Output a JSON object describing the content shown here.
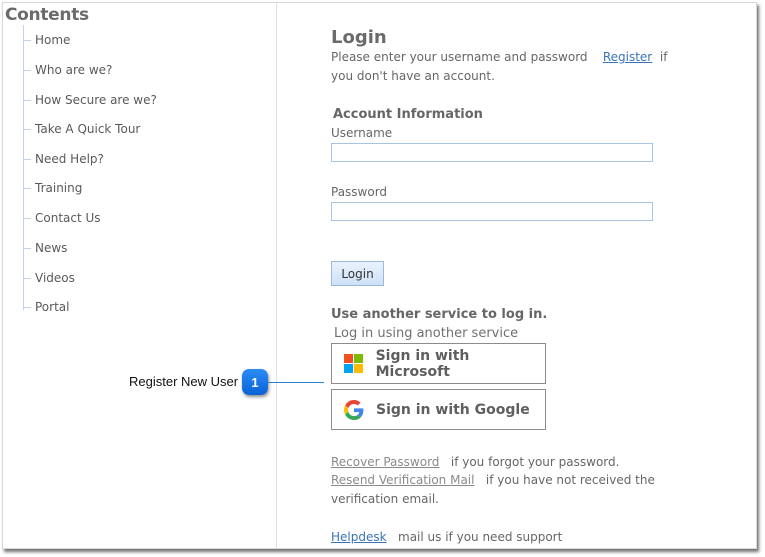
{
  "sidebar": {
    "title": "Contents",
    "items": [
      {
        "label": "Home"
      },
      {
        "label": "Who are we?"
      },
      {
        "label": "How Secure are we?"
      },
      {
        "label": "Take A Quick Tour"
      },
      {
        "label": "Need Help?"
      },
      {
        "label": "Training"
      },
      {
        "label": "Contact Us"
      },
      {
        "label": "News"
      },
      {
        "label": "Videos"
      },
      {
        "label": "Portal"
      }
    ]
  },
  "login": {
    "title": "Login",
    "intro_text": "Please enter your username and password",
    "register_link": "Register",
    "intro_suffix": "if",
    "intro_line2": "you don't have an account.",
    "account_info_heading": "Account Information",
    "username_label": "Username",
    "username_value": "",
    "password_label": "Password",
    "password_value": "",
    "login_button": "Login",
    "other_service_heading": "Use another service to log in.",
    "other_service_sub": "Log in using another service",
    "microsoft_button": "Sign in with Microsoft",
    "google_button": "Sign in with Google",
    "recover_link": "Recover Password",
    "recover_text": "if you forgot your password.",
    "resend_link": "Resend Verification Mail",
    "resend_text": "if you have not received the",
    "resend_text2": "verification email.",
    "helpdesk_link": "Helpdesk",
    "helpdesk_text": "mail us if you need support"
  },
  "callout": {
    "number": "1",
    "label": "Register New User",
    "color": "#1a73e8"
  },
  "icons": {
    "microsoft": "microsoft-logo-icon",
    "google": "google-logo-icon"
  }
}
